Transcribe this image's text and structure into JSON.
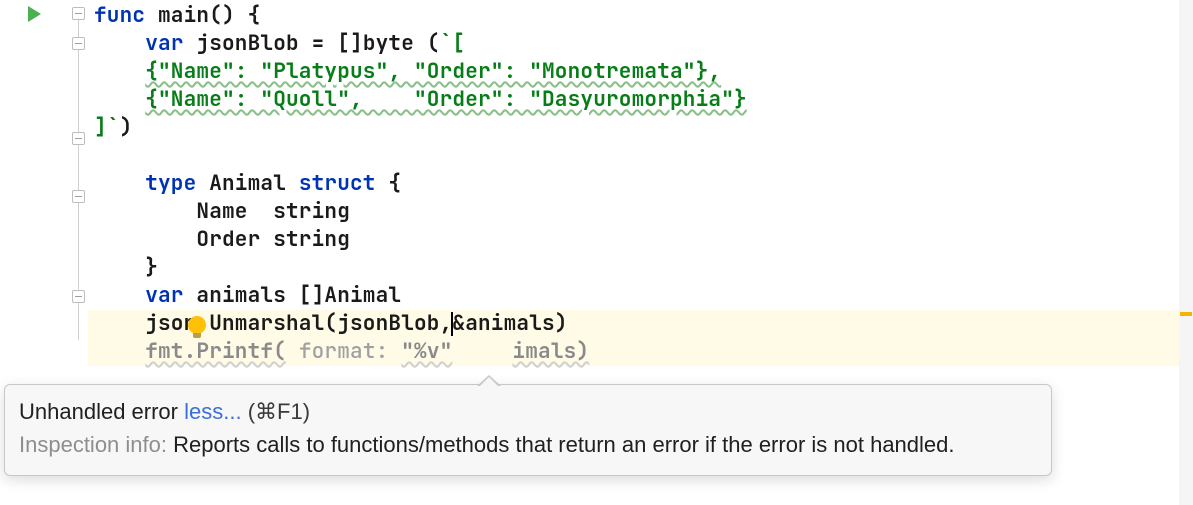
{
  "code": {
    "l1_kw_func": "func",
    "l1_ident": " main() ",
    "l1_brace": "{",
    "l2_indent": "    ",
    "l2_kw_var": "var",
    "l2_rest_a": " jsonBlob = []",
    "l2_byte": "byte",
    "l2_rest_b": " (",
    "l2_str": "`[",
    "l3_indent": "    ",
    "l3_str": "{\"Name\": \"Platypus\", \"Order\": \"Monotremata\"},",
    "l4_indent": "    ",
    "l4_str": "{\"Name\": \"Quoll\",    \"Order\": \"Dasyuromorphia\"}",
    "l5_str": "]`",
    "l5_close": ")",
    "l6_blank": " ",
    "l7_indent": "    ",
    "l7_kw_type": "type",
    "l7_ident": " Animal ",
    "l7_kw_struct": "struct",
    "l7_brace": " {",
    "l8": "        Name  string",
    "l9": "        Order string",
    "l10_indent": "    ",
    "l10_brace": "}",
    "l11_indent": "    ",
    "l11_kw_var": "var",
    "l11_rest": " animals []Animal",
    "l12_indent": "    ",
    "l12_pre": "json.Unmarshal(jsonBlob,",
    "l12_post": "&animals)",
    "l13_indent": "    ",
    "l13_a": "fmt.Printf(",
    "l13_hint": " format: ",
    "l13_b": "\"%v\"",
    "l13_c": "imals)"
  },
  "tooltip": {
    "title": "Unhandled error",
    "less": "less...",
    "shortcut": "(⌘F1)",
    "info_label": "Inspection info:",
    "info_text": " Reports calls to functions/methods that return an error if the error is not handled."
  }
}
